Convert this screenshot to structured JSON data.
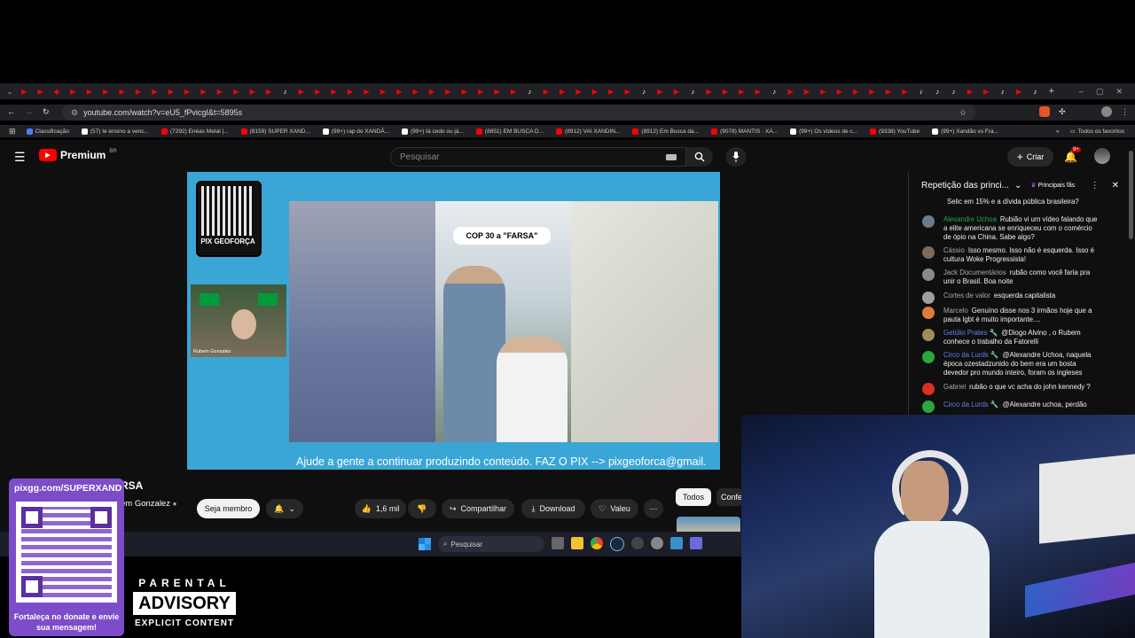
{
  "browser": {
    "tab_glyphs": [
      "▶",
      "▶",
      "◆",
      "▶",
      "▶",
      "▶",
      "▶",
      "▶",
      "▶",
      "▶",
      "▶",
      "▶",
      "▶",
      "▶",
      "▶",
      "▶",
      "♪",
      "▶",
      "▶",
      "▶",
      "▶",
      "▶",
      "▶",
      "▶",
      "▶",
      "▶",
      "▶",
      "▶",
      "▶",
      "▶",
      "▶",
      "♪",
      "▶",
      "▶",
      "▶",
      "▶",
      "▶",
      "▶",
      "♪",
      "▶",
      "▶",
      "♪",
      "▶",
      "▶",
      "▶",
      "▶",
      "♪",
      "▶",
      "▶",
      "▶",
      "▶",
      "▶",
      "▶",
      "▶",
      "▶",
      "♪",
      "♪",
      "♪",
      "▶",
      "▶",
      "♪",
      "▶",
      "♪"
    ],
    "url": "youtube.com/watch?v=eU5_fPvicgI&t=5895s",
    "bookmarks": [
      {
        "label": "Classificação",
        "color": "#4f7df5"
      },
      {
        "label": "(57) Ie ensino a venc...",
        "color": "#ffffff"
      },
      {
        "label": "(7292) Enéas Metal |...",
        "color": "#ff0000"
      },
      {
        "label": "(8159) SUPER XAND...",
        "color": "#ff0000"
      },
      {
        "label": "(99+) rap do XANDÃ...",
        "color": "#ffffff"
      },
      {
        "label": "(99+) tá cedo ou já...",
        "color": "#ffffff"
      },
      {
        "label": "(8851) EM BUSCA D...",
        "color": "#ff0000"
      },
      {
        "label": "(8912) VAI XANDIN...",
        "color": "#ff0000"
      },
      {
        "label": "(8912) Em Busca da...",
        "color": "#ff0000"
      },
      {
        "label": "(9078) MANTIS · XA...",
        "color": "#ff0000"
      },
      {
        "label": "(99+) Os vídeos de c...",
        "color": "#ffffff"
      },
      {
        "label": "(9338) YouTube",
        "color": "#ff0000"
      },
      {
        "label": "(99+) Xandão vs Fra...",
        "color": "#ffffff"
      }
    ],
    "all_bookmarks": "Todos os favoritos"
  },
  "youtube": {
    "logo_text": "Premium",
    "logo_region": "BR",
    "search_placeholder": "Pesquisar",
    "create_label": "Criar",
    "notif_badge": "9+",
    "video": {
      "banner_text": "COP 30 a \"FARSA\"",
      "qr_caption": "PIX GEOFORÇA",
      "webcam_name": "Rubem Gonzalez",
      "subtitle": "Ajude a gente a continuar produzindo conteúdo. FAZ O PIX --> pixgeoforca@gmail."
    },
    "title_fragment": "RSA",
    "channel_fragment": "em Gonzalez",
    "member_label": "Seja membro",
    "likes": "1,6 mil",
    "share_label": "Compartilhar",
    "download_label": "Download",
    "thanks_label": "Valeu",
    "chips": [
      "Todos",
      "Confe"
    ]
  },
  "chat": {
    "header_title": "Repetição das princi...",
    "top_fans": "Principais fãs",
    "messages": [
      {
        "author": "",
        "author_style": "",
        "text": "Selic em 15% e a dívida pública brasileira?",
        "avatar": "#555"
      },
      {
        "author": "Alexandre Uchoa",
        "author_style": "green",
        "text": "Rubião vi um vídeo falando que a elite americana se enriqueceu com o comércio de ópio na China. Sabe algo?",
        "avatar": "#6d7a8a"
      },
      {
        "author": "Cássio",
        "author_style": "",
        "text": "Isso mesmo. Isso não é esquerda. Isso é cultura Woke Progressista!",
        "avatar": "#7a6a60"
      },
      {
        "author": "Jack Documentários",
        "author_style": "",
        "text": "rubão como você faria pra unir o Brasil. Boa noite",
        "avatar": "#8a8a8a"
      },
      {
        "author": "Cortes de valor",
        "author_style": "",
        "text": "esquerda capitalista",
        "avatar": "#9aa0a0"
      },
      {
        "author": "Marcelo",
        "author_style": "",
        "text": "Genuíno disse nos 3 irmãos hoje que a pauta lgbt é muito importante....",
        "avatar": "#e07b39"
      },
      {
        "author": "Getúlio Prates 🔧",
        "author_style": "blue",
        "text": "@Diogo Alvino , o Rubem conhece o trabalho da Fatorelli",
        "avatar": "#a38a5a"
      },
      {
        "author": "Circo da Lurds 🔧",
        "author_style": "blue",
        "text": "@Alexandre Uchoa, naquela época ozestadzunido do bem era um bosta devedor pro mundo inteiro, foram os ingleses",
        "avatar": "#2ba640"
      },
      {
        "author": "Gabriel",
        "author_style": "",
        "text": "rubão o que vc acha do john kennedy ?",
        "avatar": "#d93025"
      },
      {
        "author": "Circo da Lurds 🔧",
        "author_style": "blue",
        "text": "@Alexandre uchoa, perdão",
        "avatar": "#2ba640"
      }
    ]
  },
  "taskbar": {
    "search_label": "Pesquisar"
  },
  "overlay": {
    "pix_url": "pixgg.com/SUPERXAND",
    "pix_caption": "Fortaleça no donate e envie sua mensagem!",
    "advisory_top": "PARENTAL",
    "advisory_mid": "ADVISORY",
    "advisory_bottom": "EXPLICIT CONTENT"
  },
  "colors": {
    "yt_red": "#ff0000",
    "video_bg": "#3aa6d6",
    "pix_purple": "#7c4cc9"
  }
}
